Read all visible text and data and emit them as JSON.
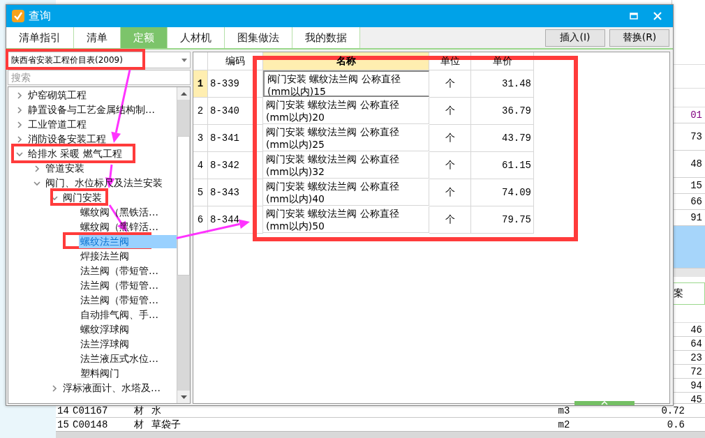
{
  "window": {
    "title": "查询"
  },
  "tabs": [
    {
      "label": "清单指引",
      "selected": false
    },
    {
      "label": "清单",
      "selected": false
    },
    {
      "label": "定额",
      "selected": true
    },
    {
      "label": "人材机",
      "selected": false
    },
    {
      "label": "图集做法",
      "selected": false
    },
    {
      "label": "我的数据",
      "selected": false
    }
  ],
  "buttons": [
    "插入(I)",
    "替换(R)"
  ],
  "library": {
    "value": "陕西省安装工程价目表(2009)"
  },
  "search": {
    "placeholder": "搜索"
  },
  "tree": [
    {
      "label": "炉窑砌筑工程",
      "expanded": false,
      "selected": false
    },
    {
      "label": "静置设备与工艺金属结构制…",
      "expanded": false,
      "selected": false
    },
    {
      "label": "工业管道工程",
      "expanded": false,
      "selected": false
    },
    {
      "label": "消防设备安装工程",
      "expanded": false,
      "selected": false
    },
    {
      "label": "给排水 采暖 燃气工程",
      "expanded": true,
      "selected": false,
      "children": [
        {
          "label": "管道安装",
          "expanded": false,
          "selected": false
        },
        {
          "label": "阀门、水位标尺及法兰安装",
          "expanded": true,
          "selected": false,
          "children": [
            {
              "label": "阀门安装",
              "expanded": true,
              "selected": false,
              "children": [
                {
                  "label": "螺纹阀（黑铁活…",
                  "selected": false
                },
                {
                  "label": "螺纹阀（黑锌活…",
                  "selected": false
                },
                {
                  "label": "螺纹法兰阀",
                  "selected": true
                },
                {
                  "label": "焊接法兰阀",
                  "selected": false
                },
                {
                  "label": "法兰阀（带短管…",
                  "selected": false
                },
                {
                  "label": "法兰阀（带短管…",
                  "selected": false
                },
                {
                  "label": "法兰阀（带短管…",
                  "selected": false
                },
                {
                  "label": "自动排气阀、手…",
                  "selected": false
                },
                {
                  "label": "螺纹浮球阀",
                  "selected": false
                },
                {
                  "label": "法兰浮球阀",
                  "selected": false
                },
                {
                  "label": "法兰液压式水位…",
                  "selected": false
                },
                {
                  "label": "塑料阀门",
                  "selected": false
                }
              ]
            },
            {
              "label": "浮标液面计、水塔及…",
              "expanded": false,
              "selected": false
            }
          ]
        }
      ]
    }
  ],
  "table": {
    "columns": [
      "编码",
      "名称",
      "单位",
      "单价"
    ],
    "rows": [
      {
        "number": "1",
        "code": "8-339",
        "name": "阀门安装 螺纹法兰阀 公称直径(mm以内)15",
        "unit": "个",
        "price": "31.48",
        "selected": true
      },
      {
        "number": "2",
        "code": "8-340",
        "name": "阀门安装 螺纹法兰阀 公称直径(mm以内)20",
        "unit": "个",
        "price": "36.79",
        "selected": false
      },
      {
        "number": "3",
        "code": "8-341",
        "name": "阀门安装 螺纹法兰阀 公称直径(mm以内)25",
        "unit": "个",
        "price": "43.79",
        "selected": false
      },
      {
        "number": "4",
        "code": "8-342",
        "name": "阀门安装 螺纹法兰阀 公称直径(mm以内)32",
        "unit": "个",
        "price": "61.15",
        "selected": false
      },
      {
        "number": "5",
        "code": "8-343",
        "name": "阀门安装 螺纹法兰阀 公称直径(mm以内)40",
        "unit": "个",
        "price": "74.09",
        "selected": false
      },
      {
        "number": "6",
        "code": "8-344",
        "name": "阀门安装 螺纹法兰阀 公称直径(mm以内)50",
        "unit": "个",
        "price": "79.75",
        "selected": false
      }
    ]
  },
  "background": {
    "upper_rows": [
      {
        "value": "01",
        "color": "#800080",
        "selected": false
      },
      {
        "value": "73",
        "color": "#000000",
        "selected": false
      },
      {
        "value": "48",
        "color": "#000000",
        "selected": false
      },
      {
        "value": "15",
        "color": "#000000",
        "selected": false
      },
      {
        "value": "66",
        "color": "#000000",
        "selected": false
      },
      {
        "value": "91",
        "color": "#000000",
        "selected": false
      },
      {
        "selected": true
      }
    ],
    "tab": "案",
    "lower_rows": [
      "46",
      "64",
      "23",
      "72",
      "94",
      "45"
    ],
    "bottom_rows": [
      {
        "number": "14",
        "code": "C01167",
        "type": "材",
        "name": "水",
        "unit": "m3",
        "amount": "0.72"
      },
      {
        "number": "15",
        "code": "C00148",
        "type": "材",
        "name": "草袋子",
        "unit": "m2",
        "amount": "0.6"
      }
    ]
  }
}
